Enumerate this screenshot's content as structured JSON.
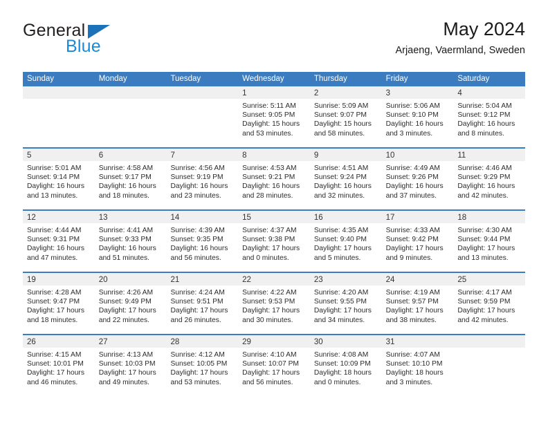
{
  "brand": {
    "name_top": "General",
    "name_bottom": "Blue",
    "color_dark": "#231f20",
    "color_blue": "#1b8ad6",
    "triangle_color": "#1b72b8"
  },
  "header": {
    "title": "May 2024",
    "subtitle": "Arjaeng, Vaermland, Sweden"
  },
  "theme": {
    "header_bg": "#3b7cc0",
    "header_text": "#ffffff",
    "daynum_band_bg": "#f0f0f0",
    "cell_bg": "#ffffff",
    "row_border": "#3b7cc0"
  },
  "calendar": {
    "weekday_headers": [
      "Sunday",
      "Monday",
      "Tuesday",
      "Wednesday",
      "Thursday",
      "Friday",
      "Saturday"
    ],
    "weeks": [
      [
        {
          "day": "",
          "lines": []
        },
        {
          "day": "",
          "lines": []
        },
        {
          "day": "",
          "lines": []
        },
        {
          "day": "1",
          "lines": [
            "Sunrise: 5:11 AM",
            "Sunset: 9:05 PM",
            "Daylight: 15 hours",
            "and 53 minutes."
          ]
        },
        {
          "day": "2",
          "lines": [
            "Sunrise: 5:09 AM",
            "Sunset: 9:07 PM",
            "Daylight: 15 hours",
            "and 58 minutes."
          ]
        },
        {
          "day": "3",
          "lines": [
            "Sunrise: 5:06 AM",
            "Sunset: 9:10 PM",
            "Daylight: 16 hours",
            "and 3 minutes."
          ]
        },
        {
          "day": "4",
          "lines": [
            "Sunrise: 5:04 AM",
            "Sunset: 9:12 PM",
            "Daylight: 16 hours",
            "and 8 minutes."
          ]
        }
      ],
      [
        {
          "day": "5",
          "lines": [
            "Sunrise: 5:01 AM",
            "Sunset: 9:14 PM",
            "Daylight: 16 hours",
            "and 13 minutes."
          ]
        },
        {
          "day": "6",
          "lines": [
            "Sunrise: 4:58 AM",
            "Sunset: 9:17 PM",
            "Daylight: 16 hours",
            "and 18 minutes."
          ]
        },
        {
          "day": "7",
          "lines": [
            "Sunrise: 4:56 AM",
            "Sunset: 9:19 PM",
            "Daylight: 16 hours",
            "and 23 minutes."
          ]
        },
        {
          "day": "8",
          "lines": [
            "Sunrise: 4:53 AM",
            "Sunset: 9:21 PM",
            "Daylight: 16 hours",
            "and 28 minutes."
          ]
        },
        {
          "day": "9",
          "lines": [
            "Sunrise: 4:51 AM",
            "Sunset: 9:24 PM",
            "Daylight: 16 hours",
            "and 32 minutes."
          ]
        },
        {
          "day": "10",
          "lines": [
            "Sunrise: 4:49 AM",
            "Sunset: 9:26 PM",
            "Daylight: 16 hours",
            "and 37 minutes."
          ]
        },
        {
          "day": "11",
          "lines": [
            "Sunrise: 4:46 AM",
            "Sunset: 9:29 PM",
            "Daylight: 16 hours",
            "and 42 minutes."
          ]
        }
      ],
      [
        {
          "day": "12",
          "lines": [
            "Sunrise: 4:44 AM",
            "Sunset: 9:31 PM",
            "Daylight: 16 hours",
            "and 47 minutes."
          ]
        },
        {
          "day": "13",
          "lines": [
            "Sunrise: 4:41 AM",
            "Sunset: 9:33 PM",
            "Daylight: 16 hours",
            "and 51 minutes."
          ]
        },
        {
          "day": "14",
          "lines": [
            "Sunrise: 4:39 AM",
            "Sunset: 9:35 PM",
            "Daylight: 16 hours",
            "and 56 minutes."
          ]
        },
        {
          "day": "15",
          "lines": [
            "Sunrise: 4:37 AM",
            "Sunset: 9:38 PM",
            "Daylight: 17 hours",
            "and 0 minutes."
          ]
        },
        {
          "day": "16",
          "lines": [
            "Sunrise: 4:35 AM",
            "Sunset: 9:40 PM",
            "Daylight: 17 hours",
            "and 5 minutes."
          ]
        },
        {
          "day": "17",
          "lines": [
            "Sunrise: 4:33 AM",
            "Sunset: 9:42 PM",
            "Daylight: 17 hours",
            "and 9 minutes."
          ]
        },
        {
          "day": "18",
          "lines": [
            "Sunrise: 4:30 AM",
            "Sunset: 9:44 PM",
            "Daylight: 17 hours",
            "and 13 minutes."
          ]
        }
      ],
      [
        {
          "day": "19",
          "lines": [
            "Sunrise: 4:28 AM",
            "Sunset: 9:47 PM",
            "Daylight: 17 hours",
            "and 18 minutes."
          ]
        },
        {
          "day": "20",
          "lines": [
            "Sunrise: 4:26 AM",
            "Sunset: 9:49 PM",
            "Daylight: 17 hours",
            "and 22 minutes."
          ]
        },
        {
          "day": "21",
          "lines": [
            "Sunrise: 4:24 AM",
            "Sunset: 9:51 PM",
            "Daylight: 17 hours",
            "and 26 minutes."
          ]
        },
        {
          "day": "22",
          "lines": [
            "Sunrise: 4:22 AM",
            "Sunset: 9:53 PM",
            "Daylight: 17 hours",
            "and 30 minutes."
          ]
        },
        {
          "day": "23",
          "lines": [
            "Sunrise: 4:20 AM",
            "Sunset: 9:55 PM",
            "Daylight: 17 hours",
            "and 34 minutes."
          ]
        },
        {
          "day": "24",
          "lines": [
            "Sunrise: 4:19 AM",
            "Sunset: 9:57 PM",
            "Daylight: 17 hours",
            "and 38 minutes."
          ]
        },
        {
          "day": "25",
          "lines": [
            "Sunrise: 4:17 AM",
            "Sunset: 9:59 PM",
            "Daylight: 17 hours",
            "and 42 minutes."
          ]
        }
      ],
      [
        {
          "day": "26",
          "lines": [
            "Sunrise: 4:15 AM",
            "Sunset: 10:01 PM",
            "Daylight: 17 hours",
            "and 46 minutes."
          ]
        },
        {
          "day": "27",
          "lines": [
            "Sunrise: 4:13 AM",
            "Sunset: 10:03 PM",
            "Daylight: 17 hours",
            "and 49 minutes."
          ]
        },
        {
          "day": "28",
          "lines": [
            "Sunrise: 4:12 AM",
            "Sunset: 10:05 PM",
            "Daylight: 17 hours",
            "and 53 minutes."
          ]
        },
        {
          "day": "29",
          "lines": [
            "Sunrise: 4:10 AM",
            "Sunset: 10:07 PM",
            "Daylight: 17 hours",
            "and 56 minutes."
          ]
        },
        {
          "day": "30",
          "lines": [
            "Sunrise: 4:08 AM",
            "Sunset: 10:09 PM",
            "Daylight: 18 hours",
            "and 0 minutes."
          ]
        },
        {
          "day": "31",
          "lines": [
            "Sunrise: 4:07 AM",
            "Sunset: 10:10 PM",
            "Daylight: 18 hours",
            "and 3 minutes."
          ]
        },
        {
          "day": "",
          "lines": []
        }
      ]
    ]
  }
}
